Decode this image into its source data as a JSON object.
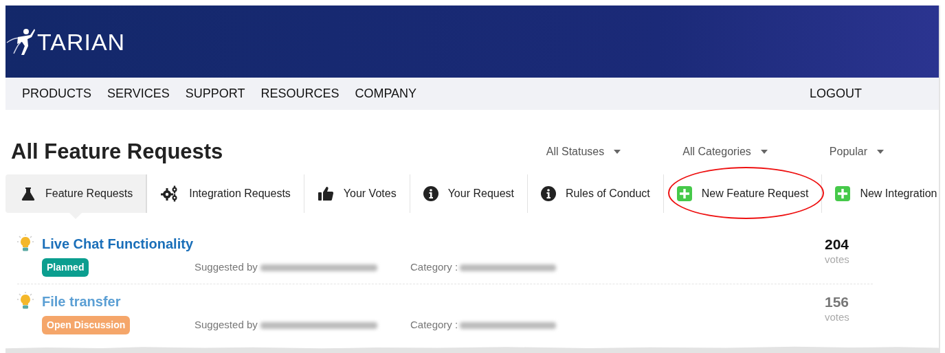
{
  "header": {
    "logo": "TARIAN"
  },
  "nav": {
    "items": [
      "PRODUCTS",
      "SERVICES",
      "SUPPORT",
      "RESOURCES",
      "COMPANY"
    ],
    "logout": "LOGOUT"
  },
  "page_title": "All Feature Requests",
  "filters": [
    {
      "label": "All Statuses"
    },
    {
      "label": "All Categories"
    },
    {
      "label": "Popular"
    }
  ],
  "tabs": [
    {
      "label": "Feature Requests",
      "kind": "flask",
      "selected": true,
      "circled": false
    },
    {
      "label": "Integration Requests",
      "kind": "gears",
      "selected": false,
      "circled": false
    },
    {
      "label": "Your Votes",
      "kind": "thumb",
      "selected": false,
      "circled": false
    },
    {
      "label": "Your Request",
      "kind": "info",
      "selected": false,
      "circled": false
    },
    {
      "label": "Rules of Conduct",
      "kind": "info",
      "selected": false,
      "circled": false
    },
    {
      "label": "New Feature Request",
      "kind": "plus",
      "selected": false,
      "circled": true
    },
    {
      "label": "New Integration",
      "kind": "plus",
      "selected": false,
      "circled": false
    }
  ],
  "requests": [
    {
      "title": "Live Chat Functionality",
      "status": "Planned",
      "color": "#0b9e8f",
      "suggested_by_label": "Suggested by",
      "category_label": "Category :",
      "votes": "204",
      "votes_label": "votes"
    },
    {
      "title": "File transfer",
      "status": "Open Discussion",
      "color": "#f5a66a",
      "suggested_by_label": "Suggested by",
      "category_label": "Category :",
      "votes": "156",
      "votes_label": "votes"
    }
  ]
}
